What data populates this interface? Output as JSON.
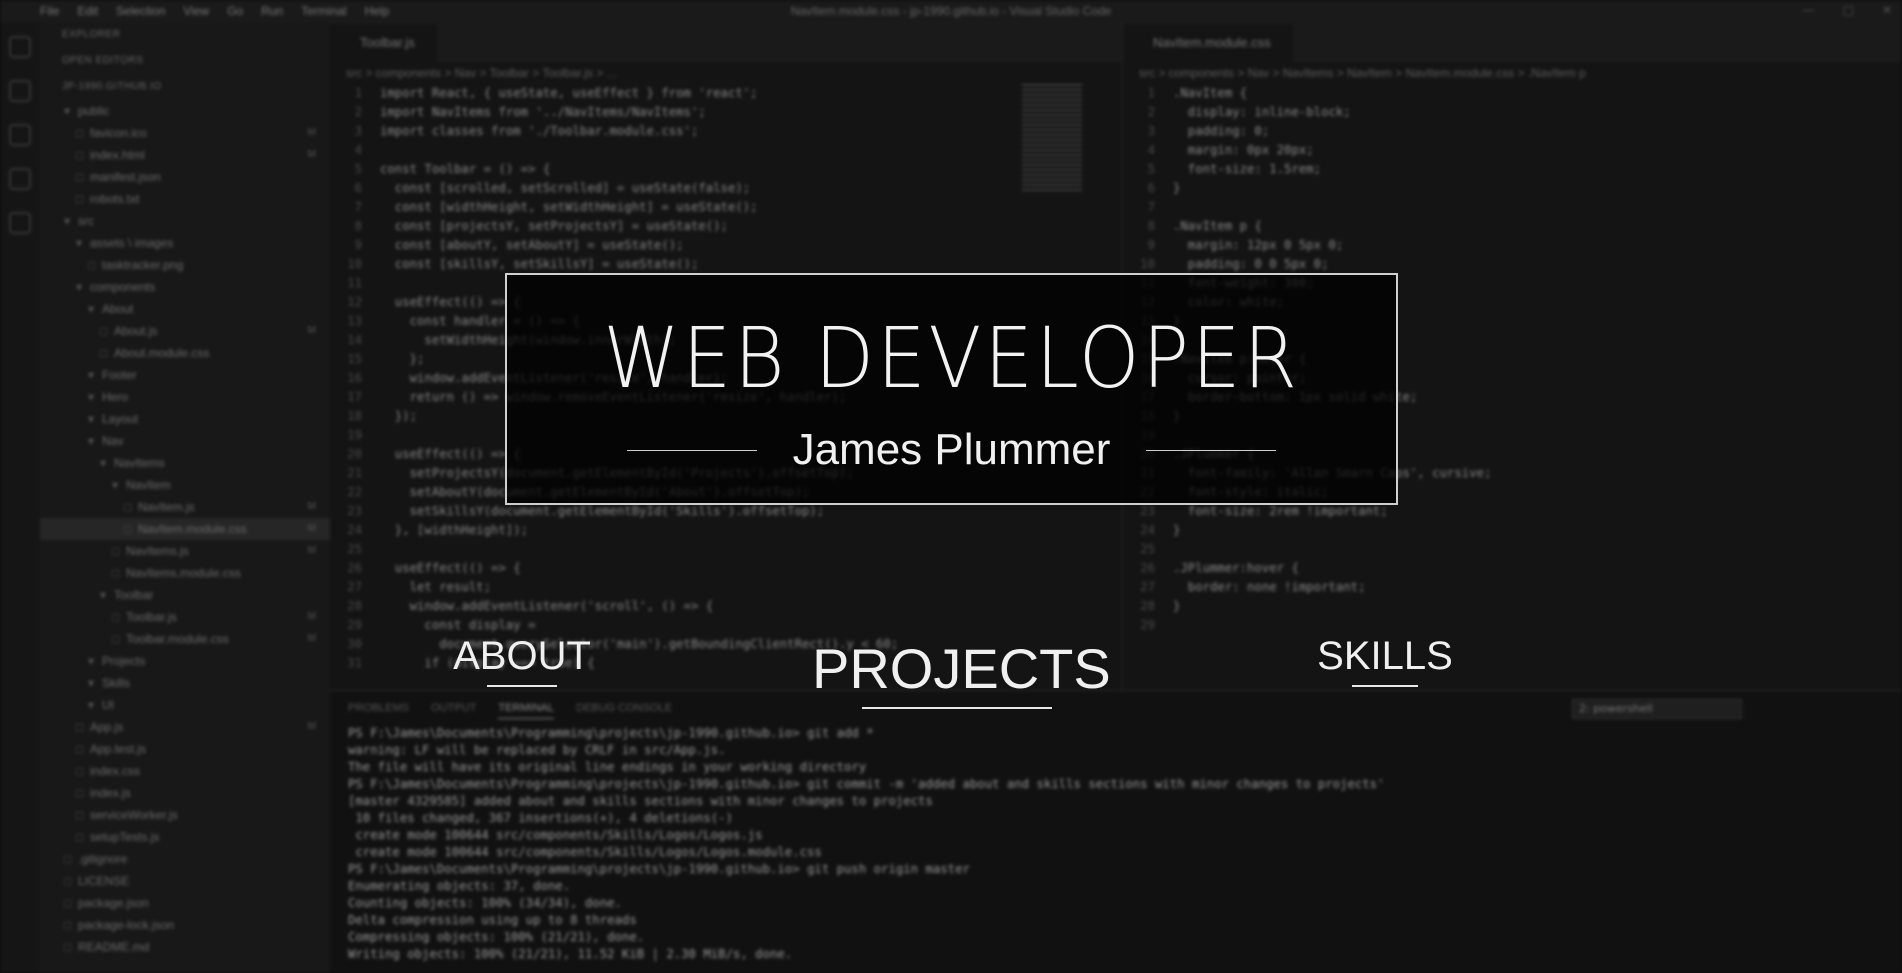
{
  "hero": {
    "title": "WEB DEVELOPER",
    "subtitle": "James Plummer"
  },
  "nav": {
    "about": "ABOUT",
    "projects": "PROJECTS",
    "skills": "SKILLS"
  },
  "background_editor": {
    "app_title": "NavItem.module.css - jp-1990.github.io - Visual Studio Code",
    "menu": [
      "File",
      "Edit",
      "Selection",
      "View",
      "Go",
      "Run",
      "Terminal",
      "Help"
    ],
    "explorer": {
      "header": "EXPLORER",
      "open_editors": "OPEN EDITORS",
      "project": "JP-1990.GITHUB.IO",
      "tree": [
        {
          "name": "public",
          "depth": 1,
          "folder": true
        },
        {
          "name": "favicon.ico",
          "depth": 2,
          "badge": "M"
        },
        {
          "name": "index.html",
          "depth": 2,
          "badge": "M"
        },
        {
          "name": "manifest.json",
          "depth": 2
        },
        {
          "name": "robots.txt",
          "depth": 2
        },
        {
          "name": "src",
          "depth": 1,
          "folder": true
        },
        {
          "name": "assets \\ images",
          "depth": 2,
          "folder": true
        },
        {
          "name": "tasktracker.png",
          "depth": 3
        },
        {
          "name": "components",
          "depth": 2,
          "folder": true
        },
        {
          "name": "About",
          "depth": 3,
          "folder": true
        },
        {
          "name": "About.js",
          "depth": 4,
          "badge": "M"
        },
        {
          "name": "About.module.css",
          "depth": 4
        },
        {
          "name": "Footer",
          "depth": 3,
          "folder": true
        },
        {
          "name": "Hero",
          "depth": 3,
          "folder": true
        },
        {
          "name": "Layout",
          "depth": 3,
          "folder": true
        },
        {
          "name": "Nav",
          "depth": 3,
          "folder": true
        },
        {
          "name": "NavItems",
          "depth": 4,
          "folder": true
        },
        {
          "name": "NavItem",
          "depth": 5,
          "folder": true
        },
        {
          "name": "NavItem.js",
          "depth": 6,
          "badge": "M"
        },
        {
          "name": "NavItem.module.css",
          "depth": 6,
          "badge": "M",
          "selected": true
        },
        {
          "name": "NavItems.js",
          "depth": 5,
          "badge": "M"
        },
        {
          "name": "NavItems.module.css",
          "depth": 5
        },
        {
          "name": "Toolbar",
          "depth": 4,
          "folder": true
        },
        {
          "name": "Toolbar.js",
          "depth": 5,
          "badge": "M"
        },
        {
          "name": "Toolbar.module.css",
          "depth": 5,
          "badge": "M"
        },
        {
          "name": "Projects",
          "depth": 3,
          "folder": true
        },
        {
          "name": "Skills",
          "depth": 3,
          "folder": true
        },
        {
          "name": "UI",
          "depth": 3,
          "folder": true
        },
        {
          "name": "App.js",
          "depth": 2,
          "badge": "M"
        },
        {
          "name": "App.test.js",
          "depth": 2
        },
        {
          "name": "index.css",
          "depth": 2
        },
        {
          "name": "index.js",
          "depth": 2
        },
        {
          "name": "serviceWorker.js",
          "depth": 2
        },
        {
          "name": "setupTests.js",
          "depth": 2
        },
        {
          "name": ".gitignore",
          "depth": 1
        },
        {
          "name": "LICENSE",
          "depth": 1
        },
        {
          "name": "package.json",
          "depth": 1
        },
        {
          "name": "package-lock.json",
          "depth": 1
        },
        {
          "name": "README.md",
          "depth": 1
        }
      ]
    },
    "left_tab": "Toolbar.js",
    "left_crumbs": "src > components > Nav > Toolbar > Toolbar.js > ...",
    "left_code": [
      "import React, { useState, useEffect } from 'react';",
      "import NavItems from '../NavItems/NavItems';",
      "import classes from './Toolbar.module.css';",
      "",
      "const Toolbar = () => {",
      "  const [scrolled, setScrolled] = useState(false);",
      "  const [widthHeight, setWidthHeight] = useState();",
      "  const [projectsY, setProjectsY] = useState();",
      "  const [aboutY, setAboutY] = useState();",
      "  const [skillsY, setSkillsY] = useState();",
      "",
      "  useEffect(() => {",
      "    const handler = () => {",
      "      setWidthHeight(window.innerWidth);",
      "    };",
      "    window.addEventListener('resize', handler);",
      "    return () => window.removeEventListener('resize', handler);",
      "  });",
      "",
      "  useEffect(() => {",
      "    setProjectsY(document.getElementById('Projects').offsetTop);",
      "    setAboutY(document.getElementById('About').offsetTop);",
      "    setSkillsY(document.getElementById('Skills').offsetTop);",
      "  }, [widthHeight]);",
      "",
      "  useEffect(() => {",
      "    let result;",
      "    window.addEventListener('scroll', () => {",
      "      const display =",
      "        document.querySelector('main').getBoundingClientRect().y < 60;",
      "      if (display === true) {"
    ],
    "right_tab": "NavItem.module.css",
    "right_crumbs": "src > components > Nav > NavItems > NavItem > NavItem.module.css > .NavItem p",
    "right_code": [
      ".NavItem {",
      "  display: inline-block;",
      "  padding: 0;",
      "  margin: 0px 20px;",
      "  font-size: 1.5rem;",
      "}",
      "",
      ".NavItem p {",
      "  margin: 12px 0 5px 0;",
      "  padding: 0 0 5px 0;",
      "  font-weight: 300;",
      "  color: white;",
      "}",
      "",
      ".NavItem p:hover {",
      "  cursor: pointer;",
      "  border-bottom: 1px solid white;",
      "}",
      "",
      ".JPlummer {",
      "  font-family: 'Allan Smarn Caps', cursive;",
      "  font-style: italic;",
      "  font-size: 2rem !important;",
      "}",
      "",
      ".JPlummer:hover {",
      "  border: none !important;",
      "}",
      ""
    ],
    "panel_tabs": [
      "PROBLEMS",
      "OUTPUT",
      "TERMINAL",
      "DEBUG CONSOLE"
    ],
    "terminal_select": "2: powershell",
    "terminal": [
      "PS F:\\James\\Documents\\Programming\\projects\\jp-1990.github.io> git add *",
      "warning: LF will be replaced by CRLF in src/App.js.",
      "The file will have its original line endings in your working directory",
      "PS F:\\James\\Documents\\Programming\\projects\\jp-1990.github.io> git commit -m 'added about and skills sections with minor changes to projects'",
      "[master 4329585] added about and skills sections with minor changes to projects",
      " 10 files changed, 367 insertions(+), 4 deletions(-)",
      " create mode 100644 src/components/Skills/Logos/Logos.js",
      " create mode 100644 src/components/Skills/Logos/Logos.module.css",
      "PS F:\\James\\Documents\\Programming\\projects\\jp-1990.github.io> git push origin master",
      "Enumerating objects: 37, done.",
      "Counting objects: 100% (34/34), done.",
      "Delta compression using up to 8 threads",
      "Compressing objects: 100% (21/21), done.",
      "Writing objects: 100% (21/21), 11.52 KiB | 2.30 MiB/s, done."
    ]
  },
  "colors": {
    "background": "#0b0b0b",
    "hero_border": "#cfcfcf",
    "hero_text": "#f2f2f2"
  }
}
